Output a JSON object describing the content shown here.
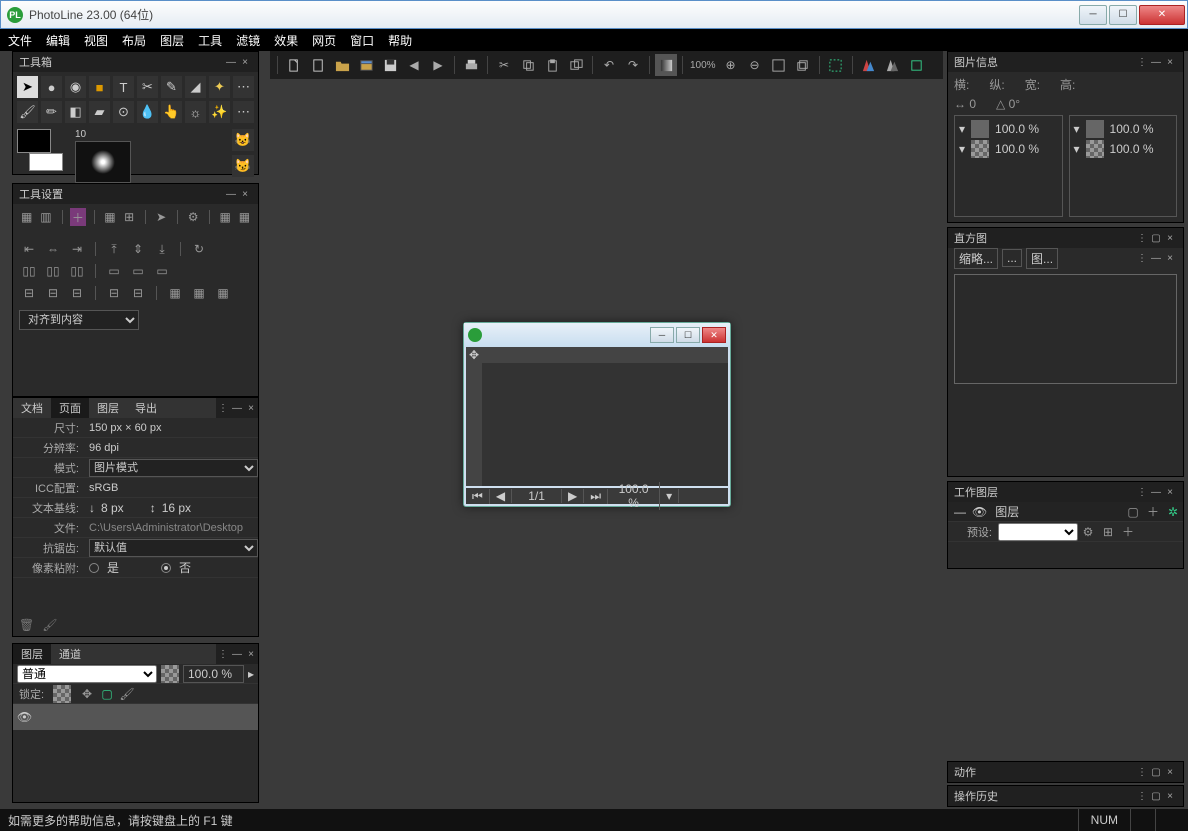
{
  "title": "PhotoLine 23.00 (64位)",
  "menu": [
    "文件",
    "编辑",
    "视图",
    "布局",
    "图层",
    "工具",
    "滤镜",
    "效果",
    "网页",
    "窗口",
    "帮助"
  ],
  "toolbox": {
    "title": "工具箱",
    "brush_size": "10"
  },
  "tool_settings": {
    "title": "工具设置",
    "align_select": "对齐到内容"
  },
  "doc_panel": {
    "tabs": [
      "文档",
      "页面",
      "图层",
      "导出"
    ],
    "size_label": "尺寸:",
    "size_val": "150 px  ×  60 px",
    "res_label": "分辨率:",
    "res_val": "96 dpi",
    "mode_label": "模式:",
    "mode_val": "图片模式",
    "icc_label": "ICC配置:",
    "icc_val": "sRGB",
    "baseline_label": "文本基线:",
    "baseline_v1": "8 px",
    "baseline_v2": "16 px",
    "file_label": "文件:",
    "file_val": "C:\\Users\\Administrator\\Desktop",
    "aa_label": "抗锯齿:",
    "aa_val": "默认值",
    "snap_label": "像素粘附:",
    "snap_yes": "是",
    "snap_no": "否"
  },
  "layers_panel": {
    "tabs": [
      "图层",
      "通道"
    ],
    "blend": "普通",
    "opacity": "100.0 %",
    "lock": "锁定:"
  },
  "image_info": {
    "title": "图片信息",
    "labels": {
      "h": "横:",
      "v": "纵:",
      "w": "宽:",
      "ht": "高:"
    },
    "arrow_val": "0",
    "angle_val": "0°",
    "pct": "100.0 %"
  },
  "histogram": {
    "title": "直方图",
    "subtabs": [
      "缩略...",
      "...",
      "图..."
    ]
  },
  "work_layer": {
    "title": "工作图层",
    "layer_name": "图层",
    "preset": "预设:"
  },
  "actions": {
    "title": "动作"
  },
  "history": {
    "title": "操作历史"
  },
  "main_toolbar": {
    "zoom": "100%"
  },
  "doc_window": {
    "page": "1/1",
    "zoom": "100.0 %"
  },
  "statusbar": {
    "help": "如需更多的帮助信息，请按键盘上的 F1 键",
    "num": "NUM"
  }
}
